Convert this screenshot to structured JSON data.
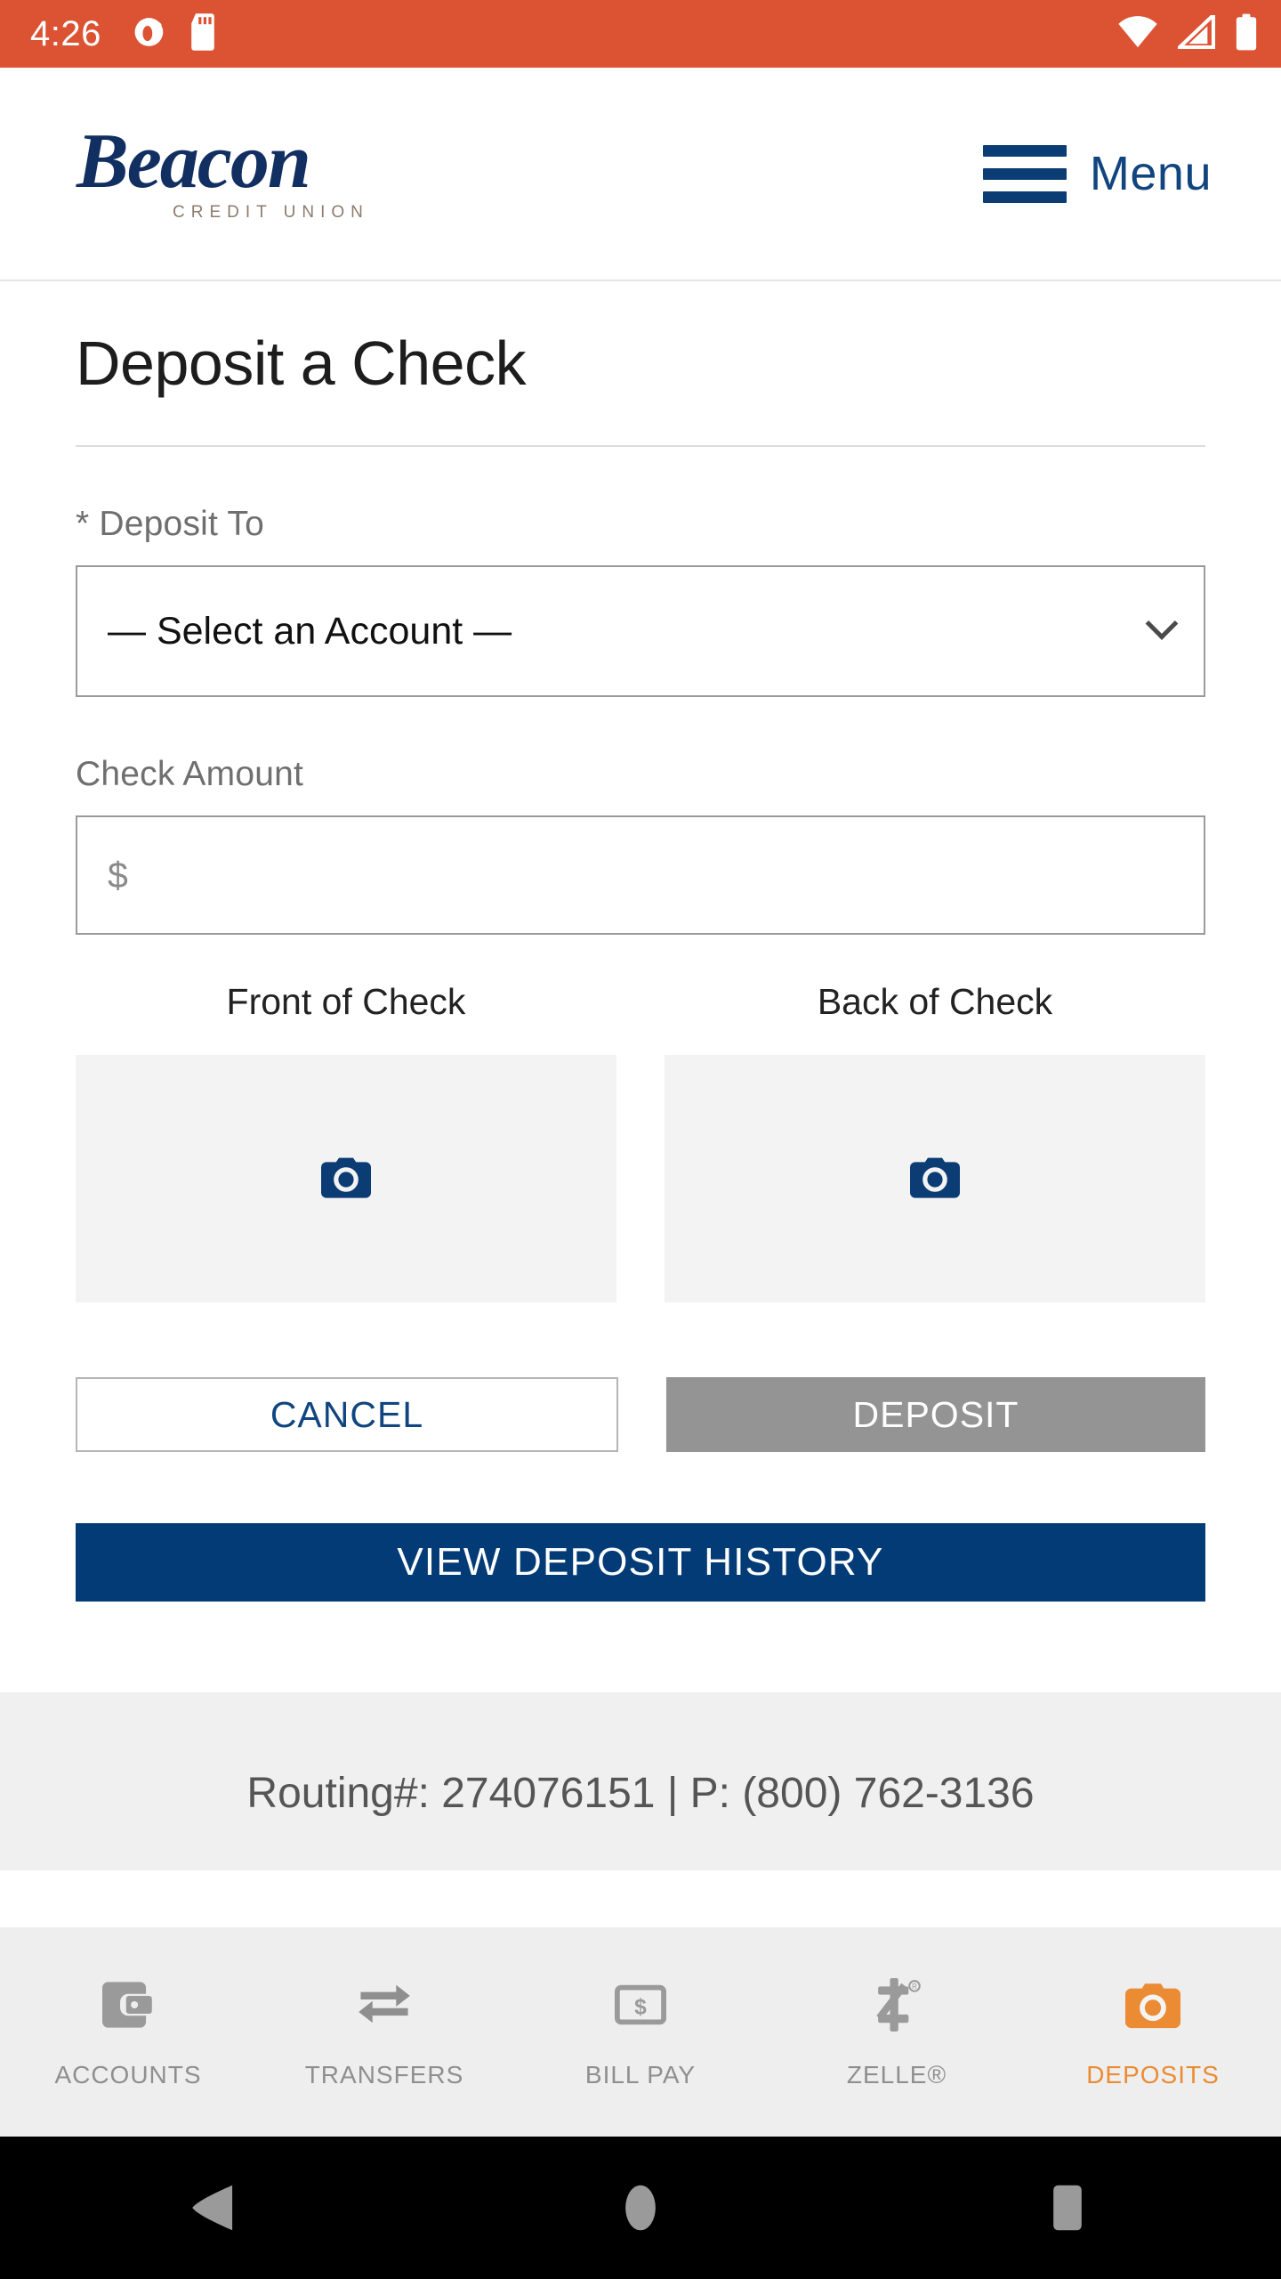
{
  "status_bar": {
    "time": "4:26",
    "background": "#DC5334",
    "left_icons": [
      "notification-icon",
      "sd-card-icon"
    ],
    "right_icons": [
      "wifi-icon",
      "cellular-signal-icon",
      "battery-icon"
    ]
  },
  "header": {
    "logo_main": "Beacon",
    "logo_sub": "CREDIT UNION",
    "menu_label": "Menu",
    "brand_navy": "#122f61"
  },
  "page": {
    "title": "Deposit a Check"
  },
  "form": {
    "deposit_to_label": "* Deposit To",
    "account_select_value": "— Select an Account —",
    "check_amount_label": "Check Amount",
    "check_amount_placeholder": "$",
    "check_amount_value": "",
    "front_caption": "Front of Check",
    "back_caption": "Back of Check"
  },
  "actions": {
    "cancel_label": "CANCEL",
    "deposit_label": "DEPOSIT",
    "deposit_disabled": true,
    "history_label": "VIEW DEPOSIT HISTORY",
    "primary_navy": "#023b76",
    "disabled_gray": "#949494"
  },
  "footer": {
    "contact_line": "Routing#: 274076151 | P: (800) 762-3136"
  },
  "tabbar": {
    "active_color": "#EB8B33",
    "inactive_color": "#8f8f8f",
    "items": [
      {
        "label": "ACCOUNTS",
        "icon": "wallet-icon",
        "active": false
      },
      {
        "label": "TRANSFERS",
        "icon": "transfer-arrows-icon",
        "active": false
      },
      {
        "label": "BILL PAY",
        "icon": "banknote-icon",
        "active": false
      },
      {
        "label": "ZELLE®",
        "icon": "zelle-z-icon",
        "active": false
      },
      {
        "label": "DEPOSITS",
        "icon": "camera-icon",
        "active": true
      }
    ]
  },
  "android_nav": {
    "buttons": [
      "back-icon",
      "home-icon",
      "recents-icon"
    ]
  }
}
